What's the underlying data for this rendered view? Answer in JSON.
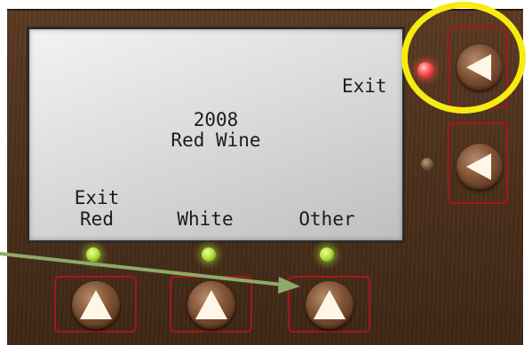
{
  "lcd": {
    "side_label": "Exit",
    "line1": "2008",
    "line2": "Red Wine",
    "soft_labels": [
      "Exit\nRed",
      "White",
      "Other"
    ]
  },
  "colors": {
    "panel": "#4a2f1b",
    "button_frame": "#a4171b",
    "highlight": "#f6ec11",
    "annotation_arrow": "#8faa68",
    "led_green": "#b6e23d",
    "led_red": "#ff5a5a"
  },
  "icons": {
    "side_buttons": "left-triangle-icon",
    "bottom_buttons": "up-triangle-icon"
  }
}
